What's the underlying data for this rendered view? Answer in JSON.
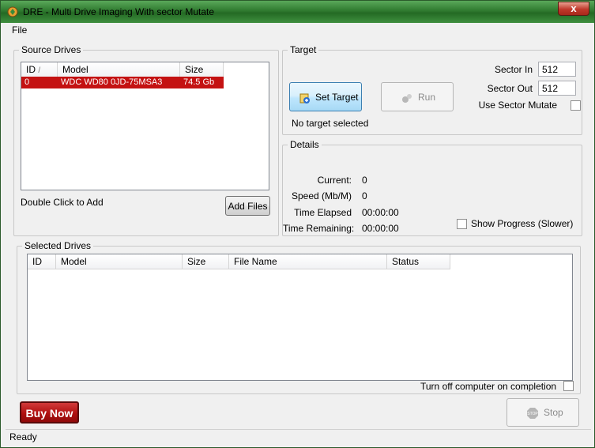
{
  "window": {
    "title": "DRE - Multi Drive Imaging With sector Mutate",
    "close_glyph": "x"
  },
  "menu": {
    "file": "File"
  },
  "source_drives": {
    "label": "Source Drives",
    "columns": [
      "ID",
      "Model",
      "Size"
    ],
    "sort_glyph": "/",
    "rows": [
      {
        "id": "0",
        "model": "WDC WD80 0JD-75MSA3",
        "size": "74.5 Gb"
      }
    ],
    "hint": "Double Click to Add",
    "add_files": "Add Files"
  },
  "target": {
    "label": "Target",
    "set_target": "Set Target",
    "run": "Run",
    "status": "No target selected",
    "sector_in_label": "Sector In",
    "sector_in_value": "512",
    "sector_out_label": "Sector Out",
    "sector_out_value": "512",
    "use_sector_mutate": "Use Sector Mutate"
  },
  "details": {
    "label": "Details",
    "current_label": "Current:",
    "current_value": "0",
    "speed_label": "Speed (Mb/M)",
    "speed_value": "0",
    "elapsed_label": "Time Elapsed",
    "elapsed_value": "00:00:00",
    "remaining_label": "Time Remaining:",
    "remaining_value": "00:00:00",
    "show_progress": "Show Progress (Slower)"
  },
  "selected_drives": {
    "label": "Selected Drives",
    "columns": [
      "ID",
      "Model",
      "Size",
      "File Name",
      "Status"
    ],
    "turn_off": "Turn off computer on completion"
  },
  "buy_now": "Buy Now",
  "stop": "Stop",
  "stop_icon_text": "STOP",
  "status_bar": "Ready",
  "colors": {
    "selection": "#c41212",
    "buy_now": "#b01010",
    "title_green": "#2f7a2f"
  }
}
